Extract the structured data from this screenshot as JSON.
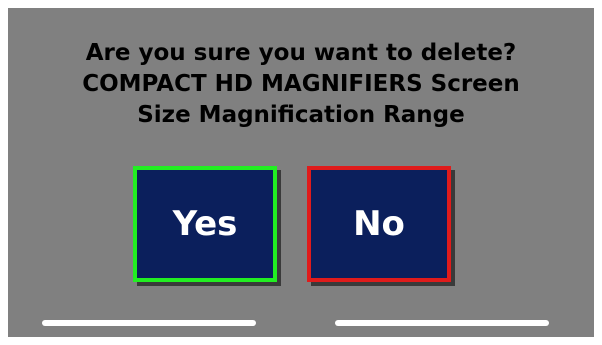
{
  "dialog": {
    "question_lines": [
      "Are you sure you want to delete?",
      "COMPACT HD MAGNIFIERS Screen",
      "Size Magnification Range"
    ],
    "yes_label": "Yes",
    "no_label": "No"
  },
  "colors": {
    "background": "#808080",
    "button_fill": "#0b1f5c",
    "yes_border": "#22ee22",
    "no_border": "#e01b1b",
    "text": "#000000",
    "button_text": "#ffffff"
  }
}
